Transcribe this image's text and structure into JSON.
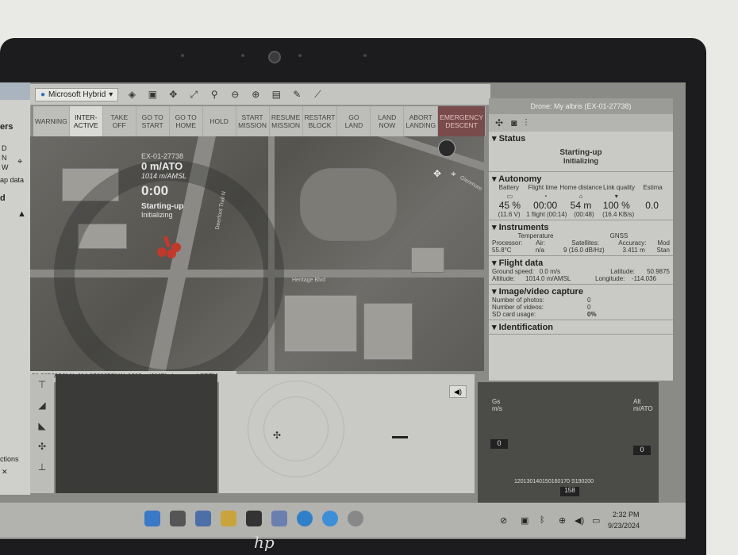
{
  "map_toolbar": {
    "layer_name": "Microsoft Hybrid"
  },
  "commands": [
    {
      "label": "WARNING"
    },
    {
      "label": "INTER-\nACTIVE",
      "active": true
    },
    {
      "label": "TAKE\nOFF"
    },
    {
      "label": "GO TO\nSTART"
    },
    {
      "label": "GO TO\nHOME"
    },
    {
      "label": "HOLD"
    },
    {
      "label": "START\nMISSION"
    },
    {
      "label": "RESUME\nMISSION"
    },
    {
      "label": "RESTART\nBLOCK"
    },
    {
      "label": "GO\nLAND"
    },
    {
      "label": "LAND\nNOW"
    },
    {
      "label": "ABORT\nLANDING"
    },
    {
      "label": "EMERGENCY\nDESCENT",
      "danger": true
    }
  ],
  "left_panel": {
    "title_partial": "ers",
    "item1": "D",
    "item2": "N",
    "item3": "W",
    "item4": "ap data",
    "item5": "d",
    "bottom": "ctions"
  },
  "hud": {
    "drone_id": "EX-01-27738",
    "altitude": "0 m/ATO",
    "amsl": "1014 m/AMSL",
    "flight_time": "0:00",
    "status": "Starting-up",
    "substatus": "Initializing"
  },
  "map_labels": {
    "street1": "Deerfoot Trail N",
    "street2": "Heritage Blvd",
    "street3": "Glenmore"
  },
  "coord_bar": "50.9856936° N, 114.0360652° W, 1019 m/AMSL, Improved SRTM",
  "right_panel": {
    "title": "Drone: My albris (EX-01-27738)",
    "status": {
      "header": "Status",
      "main": "Starting-up",
      "sub": "Initializing"
    },
    "autonomy": {
      "header": "Autonomy",
      "labels": [
        "Battery",
        "Flight time",
        "Home distance",
        "Link quality",
        "Estima"
      ],
      "values": [
        "45 %",
        "00:00",
        "54 m",
        "100 %",
        "0.0"
      ],
      "subs": [
        "(11.6 V)",
        "1 flight (00:14)",
        "(00:48)",
        "(16.4 KB/s)",
        ""
      ]
    },
    "instruments": {
      "header": "Instruments",
      "temperature": "Temperature",
      "gnss": "GNSS",
      "processor_label": "Processor:",
      "air_label": "Air:",
      "satellites_label": "Satellites:",
      "accuracy_label": "Accuracy:",
      "mode_label": "Mod",
      "processor": "55.8°C",
      "air": "n/a",
      "satellites": "9 (16.0 dB/Hz)",
      "accuracy": "3.411 m",
      "mode": "Stan"
    },
    "flight_data": {
      "header": "Flight data",
      "ground_speed_label": "Ground speed:",
      "ground_speed": "0.0 m/s",
      "altitude_label": "Altitude:",
      "altitude": "1014.0 m/AMSL",
      "latitude_label": "Latitude:",
      "latitude": "50.9875",
      "longitude_label": "Longitude:",
      "longitude": "-114.036"
    },
    "capture": {
      "header": "Image/video capture",
      "photos_label": "Number of photos:",
      "photos": "0",
      "videos_label": "Number of videos:",
      "videos": "0",
      "sd_label": "SD card usage:",
      "sd": "0%"
    },
    "identification": {
      "header": "Identification"
    }
  },
  "pfd": {
    "gs_label": "Gs\nm/s",
    "gs_value": "0",
    "alt_label": "Alt\nm/ATO",
    "alt_value": "0",
    "heading": "158",
    "heading_ticks": "120130140150160170 S190200"
  },
  "taskbar": {
    "time": "2:32 PM",
    "date": "9/23/2024"
  },
  "colors": {
    "danger": "#7a4b4b",
    "drone_marker": "#c0392b",
    "panel": "#c9c9c5"
  }
}
